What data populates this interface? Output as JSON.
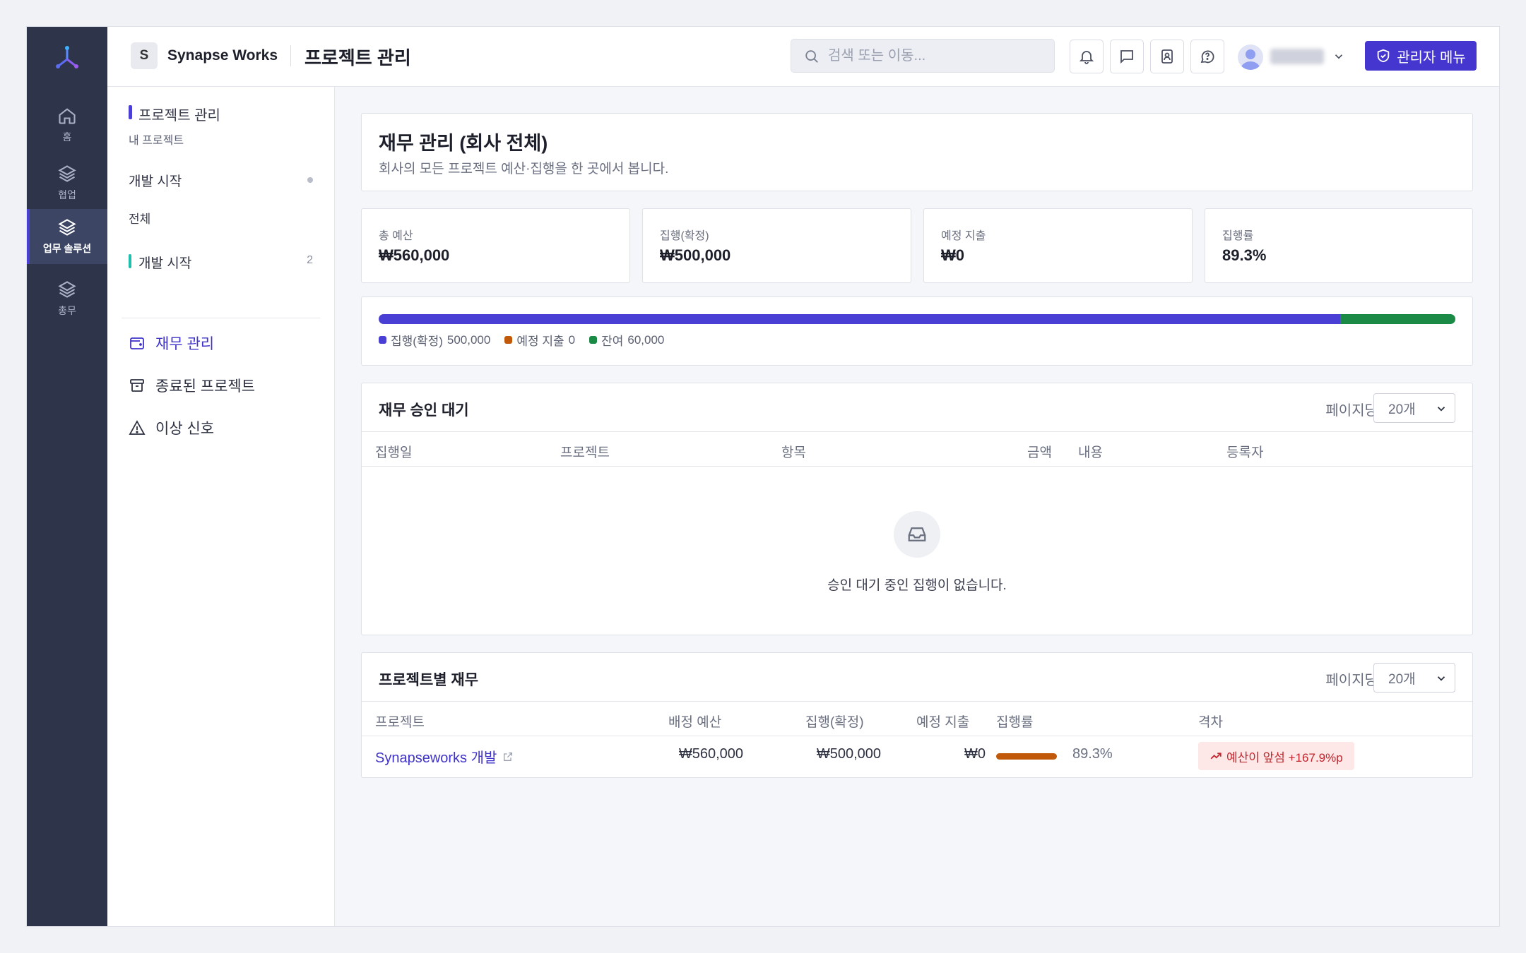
{
  "colors": {
    "accent": "#4536d0",
    "executed": "#4a3fd4",
    "planned": "#c05a0a",
    "remaining": "#1a8a45",
    "warning_text": "#c0262d",
    "warning_bg": "#fde7e7"
  },
  "rail": {
    "items": [
      {
        "label": "홈",
        "icon": "home-icon"
      },
      {
        "label": "협업",
        "icon": "layers-icon"
      },
      {
        "label": "업무 솔루션",
        "icon": "layers-icon",
        "active": true
      },
      {
        "label": "총무",
        "icon": "layers-icon"
      }
    ]
  },
  "header": {
    "org_initial": "S",
    "org_name": "Synapse Works",
    "title": "프로젝트 관리",
    "search_placeholder": "검색 또는 이동...",
    "admin_label": "관리자 메뉴"
  },
  "subnav": {
    "section": "프로젝트 관리",
    "subsection": "내 프로젝트",
    "dev_start": "개발 시작",
    "all_label": "전체",
    "dev_start_2": "개발 시작",
    "dev_start_2_count": "2",
    "links": [
      {
        "label": "재무 관리",
        "icon": "wallet-icon",
        "active": true
      },
      {
        "label": "종료된 프로젝트",
        "icon": "archive-icon"
      },
      {
        "label": "이상 신호",
        "icon": "warning-icon"
      }
    ]
  },
  "page": {
    "title": "재무 관리 (회사 전체)",
    "subtitle": "회사의 모든 프로젝트 예산·집행을 한 곳에서 봅니다."
  },
  "stats": [
    {
      "label": "총 예산",
      "value": "₩560,000"
    },
    {
      "label": "집행(확정)",
      "value": "₩500,000"
    },
    {
      "label": "예정 지출",
      "value": "₩0"
    },
    {
      "label": "집행률",
      "value": "89.3%"
    }
  ],
  "budget_bar": {
    "total": 560000,
    "segments": [
      {
        "label": "집행(확정)",
        "value": 500000,
        "value_text": "500,000",
        "color": "#4a3fd4"
      },
      {
        "label": "예정 지출",
        "value": 0,
        "value_text": "0",
        "color": "#c05a0a"
      },
      {
        "label": "잔여",
        "value": 60000,
        "value_text": "60,000",
        "color": "#1a8a45"
      }
    ]
  },
  "pending": {
    "title": "재무 승인 대기",
    "per_page_label": "페이지당",
    "per_page_value": "20개",
    "columns": [
      "집행일",
      "프로젝트",
      "항목",
      "금액",
      "내용",
      "등록자"
    ],
    "empty_text": "승인 대기 중인 집행이 없습니다."
  },
  "by_project": {
    "title": "프로젝트별 재무",
    "per_page_label": "페이지당",
    "per_page_value": "20개",
    "columns": [
      "프로젝트",
      "배정 예산",
      "집행(확정)",
      "예정 지출",
      "집행률",
      "격차"
    ],
    "rows": [
      {
        "project": "Synapseworks 개발",
        "budget": "₩560,000",
        "executed": "₩500,000",
        "planned": "₩0",
        "rate": 89.3,
        "rate_text": "89.3%",
        "gap": "예산이 앞섬 +167.9%p"
      }
    ]
  }
}
